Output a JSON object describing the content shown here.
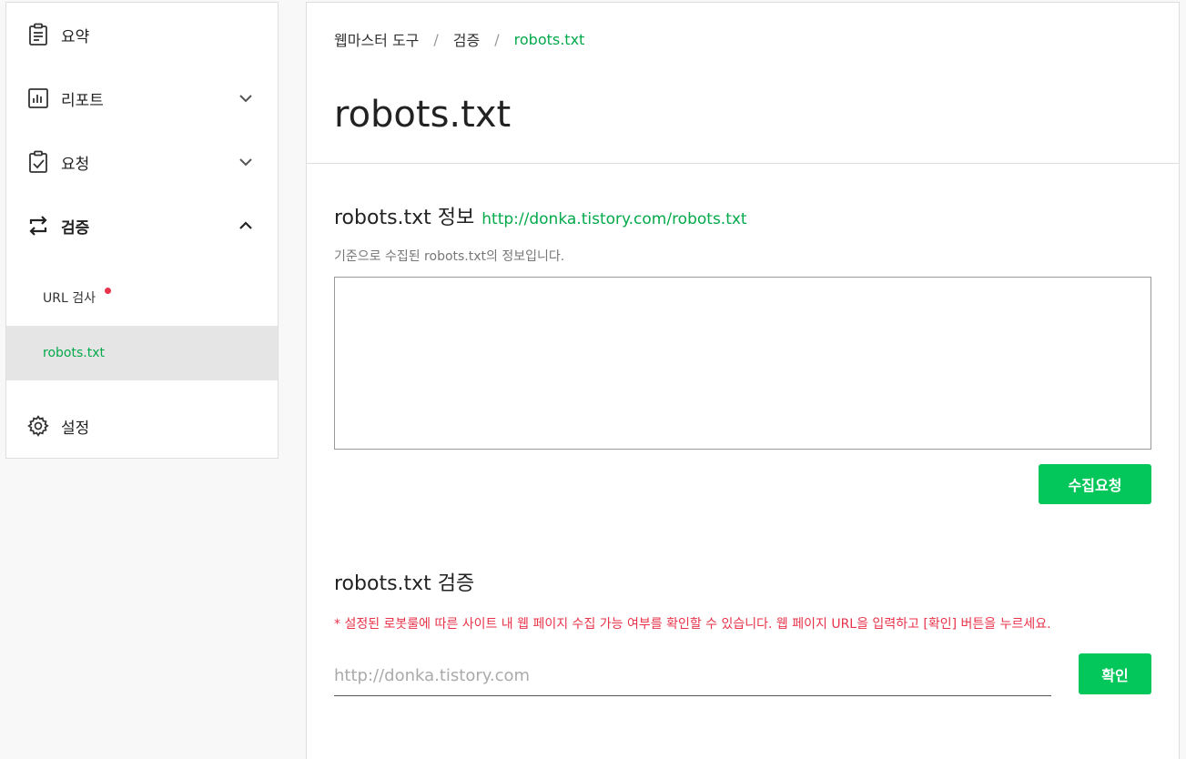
{
  "sidebar": {
    "items": [
      {
        "label": "요약",
        "icon": "clipboard-icon"
      },
      {
        "label": "리포트",
        "icon": "bar-chart-icon"
      },
      {
        "label": "요청",
        "icon": "clipboard-check-icon"
      },
      {
        "label": "검증",
        "icon": "swap-arrows-icon"
      },
      {
        "label": "설정",
        "icon": "gear-icon"
      }
    ],
    "sub_items": [
      {
        "label": "URL 검사"
      },
      {
        "label": "robots.txt"
      }
    ]
  },
  "breadcrumb": {
    "items": [
      "웹마스터 도구",
      "검증",
      "robots.txt"
    ],
    "separator": "/"
  },
  "page": {
    "title": "robots.txt"
  },
  "info_section": {
    "title": "robots.txt 정보",
    "url": "http://donka.tistory.com/robots.txt",
    "description": "기준으로 수집된 robots.txt의 정보입니다.",
    "content": "",
    "request_button": "수집요청"
  },
  "verify_section": {
    "title": "robots.txt 검증",
    "notice": "* 설정된 로봇룰에 따른 사이트 내 웹 페이지 수집 가능 여부를 확인할 수 있습니다. 웹 페이지 URL을 입력하고 [확인] 버튼을 누르세요.",
    "input_placeholder": "http://donka.tistory.com",
    "input_value": "",
    "confirm_button": "확인"
  },
  "colors": {
    "accent": "#03c75a",
    "accent_text": "#03a94a",
    "alert": "#e8334a"
  }
}
